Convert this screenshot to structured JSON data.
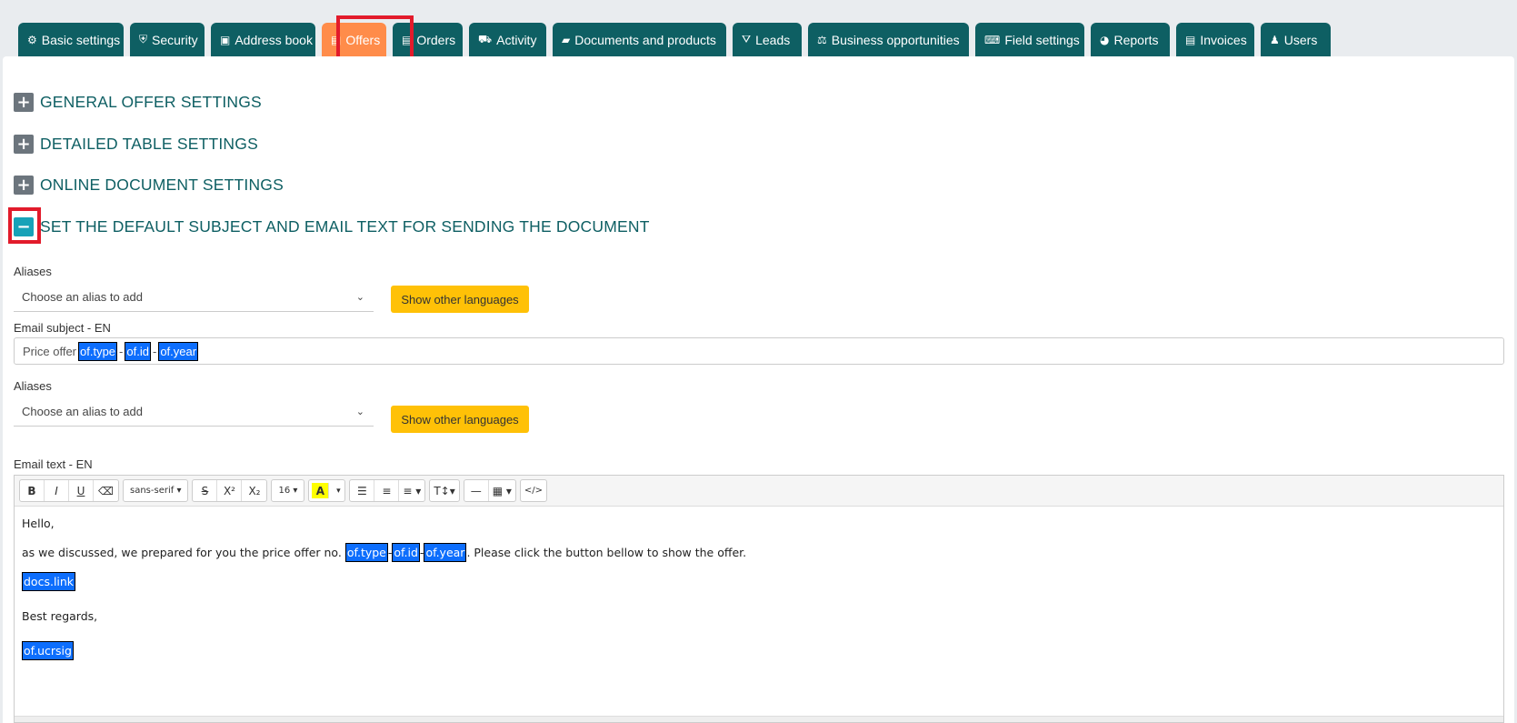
{
  "tabs": [
    {
      "label": "Basic settings",
      "icon": "gears-icon",
      "glyph": "⚙"
    },
    {
      "label": "Security",
      "icon": "shield-icon",
      "glyph": "⛨"
    },
    {
      "label": "Address book",
      "icon": "address-card-icon",
      "glyph": "▣"
    },
    {
      "label": "Offers",
      "icon": "file-icon",
      "glyph": "▤",
      "active": true
    },
    {
      "label": "Orders",
      "icon": "file-icon",
      "glyph": "▤"
    },
    {
      "label": "Activity",
      "icon": "truck-icon",
      "glyph": "⛟"
    },
    {
      "label": "Documents and products",
      "icon": "folder-icon",
      "glyph": "▰"
    },
    {
      "label": "Leads",
      "icon": "funnel-icon",
      "glyph": "⛛"
    },
    {
      "label": "Business opportunities",
      "icon": "scale-icon",
      "glyph": "⚖"
    },
    {
      "label": "Field settings",
      "icon": "keyboard-icon",
      "glyph": "⌨"
    },
    {
      "label": "Reports",
      "icon": "pie-chart-icon",
      "glyph": "◕"
    },
    {
      "label": "Invoices",
      "icon": "file-invoice-icon",
      "glyph": "▤"
    },
    {
      "label": "Users",
      "icon": "users-icon",
      "glyph": "♟"
    }
  ],
  "sections": {
    "general": "GENERAL OFFER SETTINGS",
    "table": "DETAILED TABLE SETTINGS",
    "online": "ONLINE DOCUMENT SETTINGS",
    "email": "SET THE DEFAULT SUBJECT AND EMAIL TEXT FOR SENDING THE DOCUMENT",
    "plus": "+",
    "minus": "−"
  },
  "subject_block": {
    "aliases_label": "Aliases",
    "alias_placeholder": "Choose an alias to add",
    "show_languages": "Show other languages",
    "field_label": "Email subject - EN",
    "prefix": "Price offer",
    "tags": [
      "of.type",
      "of.id",
      "of.year"
    ],
    "separator": "-"
  },
  "text_block": {
    "aliases_label": "Aliases",
    "alias_placeholder": "Choose an alias to add",
    "show_languages": "Show other languages",
    "field_label": "Email text - EN"
  },
  "toolbar": {
    "bold": "B",
    "italic": "I",
    "underline": "U",
    "eraser": "⌫",
    "font": "sans-serif ▾",
    "strike": "S",
    "sup": "X²",
    "sub": "X₂",
    "size": "16 ▾",
    "color": "A",
    "color_caret": "▾",
    "ul": "☰",
    "ol": "≡",
    "align": "≡ ▾",
    "lineheight": "T↕▾",
    "hr": "—",
    "table": "▦ ▾",
    "code": "</>"
  },
  "email_body": {
    "greeting": "Hello,",
    "line_before": "as we discussed, we prepared for you the price offer no.",
    "tags": [
      "of.type",
      "of.id",
      "of.year"
    ],
    "separator": "-",
    "line_after": ". Please click the button bellow to show the offer.",
    "link_tag": "docs.link",
    "regards": "Best regards,",
    "signature_tag": "of.ucrsig"
  }
}
